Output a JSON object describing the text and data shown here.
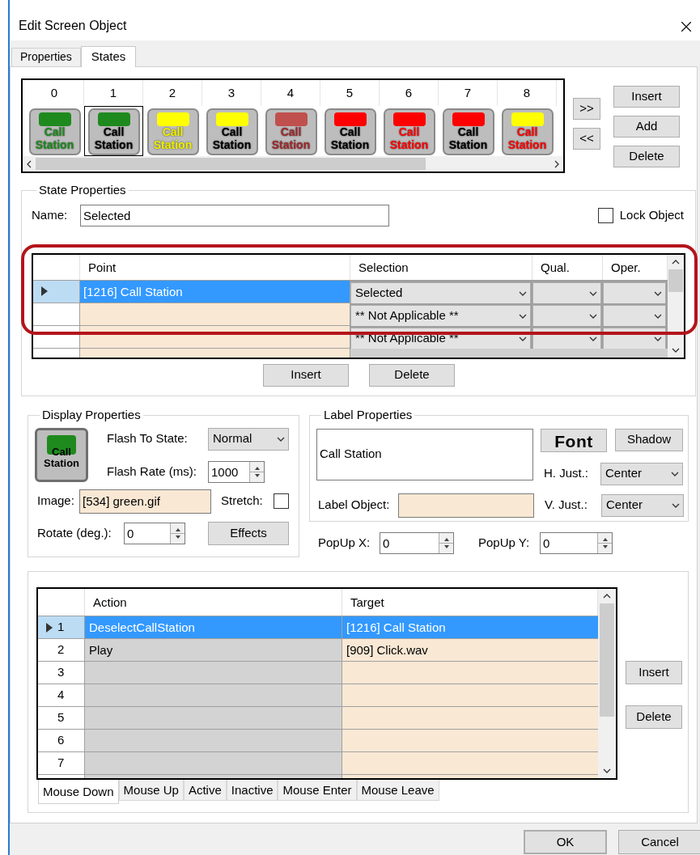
{
  "window": {
    "title": "Edit Screen Object"
  },
  "tabs": [
    {
      "label": "Properties",
      "selected": false
    },
    {
      "label": "States",
      "selected": true
    }
  ],
  "states": {
    "items": [
      {
        "number": "0",
        "color": "#1e8a1e",
        "label_top": {
          "text": "Call",
          "color": "#1e8a1e"
        },
        "label_bottom": {
          "text": "Station",
          "color": "#1e8a1e"
        },
        "selected": false
      },
      {
        "number": "1",
        "color": "#1e8a1e",
        "label_top": {
          "text": "Call",
          "color": "#000000"
        },
        "label_bottom": {
          "text": "Station",
          "color": "#000000"
        },
        "selected": true
      },
      {
        "number": "2",
        "color": "#ffff00",
        "label_top": {
          "text": "Call",
          "color": "#f0f000"
        },
        "label_bottom": {
          "text": "Station",
          "color": "#f0f000"
        },
        "selected": false
      },
      {
        "number": "3",
        "color": "#ffff00",
        "label_top": {
          "text": "Call",
          "color": "#000000"
        },
        "label_bottom": {
          "text": "Station",
          "color": "#000000"
        },
        "selected": false
      },
      {
        "number": "4",
        "color": "#c0504d",
        "label_top": {
          "text": "Call",
          "color": "#a0282c"
        },
        "label_bottom": {
          "text": "Station",
          "color": "#a0282c"
        },
        "selected": false
      },
      {
        "number": "5",
        "color": "#ff0000",
        "label_top": {
          "text": "Call",
          "color": "#000000"
        },
        "label_bottom": {
          "text": "Station",
          "color": "#000000"
        },
        "selected": false
      },
      {
        "number": "6",
        "color": "#ff0000",
        "label_top": {
          "text": "Call",
          "color": "#ff0000"
        },
        "label_bottom": {
          "text": "Station",
          "color": "#ff0000"
        },
        "selected": false
      },
      {
        "number": "7",
        "color": "#ff0000",
        "label_top": {
          "text": "Call",
          "color": "#000000"
        },
        "label_bottom": {
          "text": "Station",
          "color": "#000000"
        },
        "selected": false
      },
      {
        "number": "8",
        "color": "#ffff00",
        "label_top": {
          "text": "Call",
          "color": "#ff0000"
        },
        "label_bottom": {
          "text": "Station",
          "color": "#ff0000"
        },
        "selected": false
      }
    ],
    "nav_buttons": [
      ">>",
      "<<"
    ],
    "buttons": [
      "Insert",
      "Add",
      "Delete"
    ]
  },
  "state_properties": {
    "title": "State Properties",
    "name_label": "Name:",
    "name_value": "Selected",
    "lock_object": {
      "label": "Lock Object",
      "checked": false
    },
    "points_table": {
      "columns": [
        "Point",
        "Selection",
        "Qual.",
        "Oper."
      ],
      "rows": [
        {
          "point": "[1216] Call Station",
          "selection": "Selected",
          "selected": true
        },
        {
          "selection": "** Not Applicable **",
          "selected": false
        },
        {
          "selection": "** Not Applicable **",
          "selected": false
        }
      ]
    },
    "buttons": [
      "Insert",
      "Delete"
    ]
  },
  "display_properties": {
    "title": "Display Properties",
    "icon_label_top": "Call",
    "icon_label_bottom": "Station",
    "flash_to_state": {
      "label": "Flash To State:",
      "value": "Normal"
    },
    "flash_rate": {
      "label": "Flash Rate (ms):",
      "value": "1000"
    },
    "image": {
      "label": "Image:",
      "value": "[534] green.gif"
    },
    "stretch": {
      "label": "Stretch:",
      "checked": false
    },
    "rotate": {
      "label": "Rotate (deg.):",
      "value": "0"
    },
    "effects_button": "Effects"
  },
  "label_properties": {
    "title": "Label Properties",
    "text": "Call Station",
    "font_button": "Font",
    "shadow_button": "Shadow",
    "h_just": {
      "label": "H. Just.:",
      "value": "Center"
    },
    "label_object": {
      "label": "Label Object:"
    },
    "v_just": {
      "label": "V. Just.:",
      "value": "Center"
    }
  },
  "popup_x": {
    "label": "PopUp X:",
    "value": "0"
  },
  "popup_y": {
    "label": "PopUp Y:",
    "value": "0"
  },
  "actions": {
    "columns": [
      "Action",
      "Target"
    ],
    "rows": [
      {
        "number": "1",
        "action": "DeselectCallStation",
        "target": "[1216] Call Station",
        "selected": true
      },
      {
        "number": "2",
        "action": "Play",
        "target": "[909] Click.wav",
        "selected": false
      },
      {
        "number": "3",
        "selected": false
      },
      {
        "number": "4",
        "selected": false
      },
      {
        "number": "5",
        "selected": false
      },
      {
        "number": "6",
        "selected": false
      },
      {
        "number": "7",
        "selected": false
      }
    ],
    "buttons": [
      "Insert",
      "Delete"
    ],
    "tabs": [
      {
        "label": "Mouse Down",
        "selected": true
      },
      {
        "label": "Mouse Up",
        "selected": false
      },
      {
        "label": "Active",
        "selected": false
      },
      {
        "label": "Inactive",
        "selected": false
      },
      {
        "label": "Mouse Enter",
        "selected": false
      },
      {
        "label": "Mouse Leave",
        "selected": false
      }
    ]
  },
  "footer_buttons": [
    {
      "label": "OK",
      "default": true
    },
    {
      "label": "Cancel",
      "default": false
    }
  ]
}
